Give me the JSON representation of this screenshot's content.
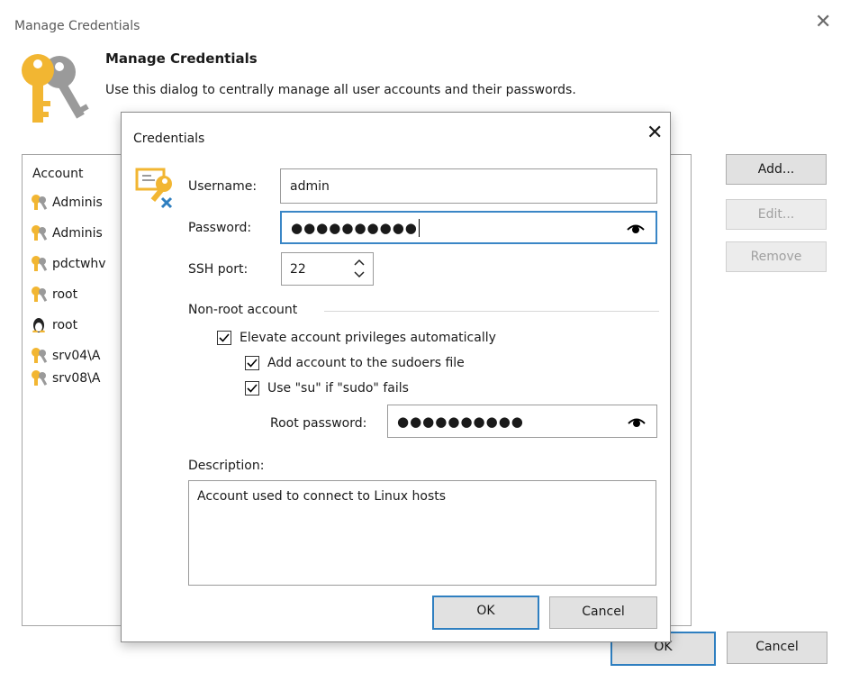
{
  "outer": {
    "window_title": "Manage Credentials",
    "heading": "Manage Credentials",
    "subtitle": "Use this dialog to centrally manage all user accounts and their passwords.",
    "list_header": "Account",
    "accounts": [
      {
        "icon": "key-icon",
        "label": "Adminis"
      },
      {
        "icon": "key-icon",
        "label": "Adminis"
      },
      {
        "icon": "key-icon",
        "label": "pdctwhv"
      },
      {
        "icon": "key-icon",
        "label": "root"
      },
      {
        "icon": "linux-penguin-icon",
        "label": "root"
      },
      {
        "icon": "key-icon",
        "label": "srv04\\A"
      },
      {
        "icon": "key-icon",
        "label": "srv08\\A"
      }
    ],
    "buttons": {
      "add": "Add...",
      "edit": "Edit...",
      "remove": "Remove",
      "ok": "OK",
      "cancel": "Cancel"
    },
    "close_glyph": "✕"
  },
  "dialog": {
    "title": "Credentials",
    "close_glyph": "✕",
    "username_label": "Username:",
    "username_value": "admin",
    "password_label": "Password:",
    "password_value": "●●●●●●●●●●",
    "ssh_port_label": "SSH port:",
    "ssh_port_value": "22",
    "non_root_group": "Non-root account",
    "elevate_label": "Elevate account privileges automatically",
    "elevate_checked": true,
    "sudoers_label": "Add account to the sudoers file",
    "sudoers_checked": true,
    "su_label": "Use \"su\" if \"sudo\" fails",
    "su_checked": true,
    "root_password_label": "Root password:",
    "root_password_value": "●●●●●●●●●●",
    "description_label": "Description:",
    "description_value": "Account used to connect to Linux hosts",
    "ok_label": "OK",
    "cancel_label": "Cancel"
  },
  "colors": {
    "accent": "#2f7fc0",
    "key_gold": "#f2b632",
    "key_gray": "#9a9a9a"
  }
}
